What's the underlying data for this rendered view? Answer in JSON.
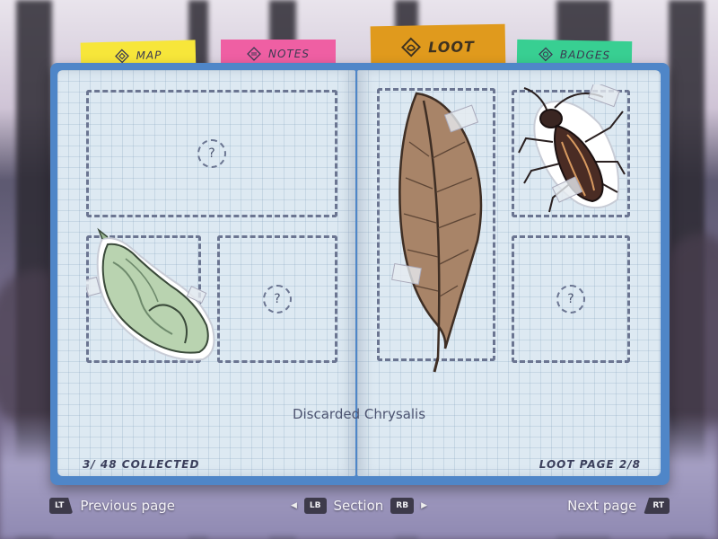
{
  "tabs": {
    "map": {
      "label": "MAP",
      "icon": "map-icon",
      "color": "#f7e63a"
    },
    "notes": {
      "label": "NOTES",
      "icon": "notes-icon",
      "color": "#ef5fa3"
    },
    "loot": {
      "label": "LOOT",
      "icon": "loot-icon",
      "color": "#e09a1d",
      "active": true
    },
    "badges": {
      "label": "BADGES",
      "icon": "badge-icon",
      "color": "#38cf92"
    }
  },
  "slots": {
    "unknown_symbol": "?"
  },
  "items": {
    "chrysalis": {
      "icon": "chrysalis-icon"
    },
    "feather": {
      "icon": "feather-icon"
    },
    "beetle": {
      "icon": "beetle-icon"
    }
  },
  "selected_item_name": "Discarded Chrysalis",
  "collected_text": "3/ 48 COLLECTED",
  "page_indicator": "LOOT PAGE   2/8",
  "nav": {
    "previous_button": "LT",
    "previous_label": "Previous page",
    "section_left_button": "LB",
    "section_label": "Section",
    "section_right_button": "RB",
    "next_label": "Next page",
    "next_button": "RT"
  },
  "colors": {
    "book_cover": "#4f86c8",
    "page": "#dde9f2",
    "dashed": "#6b7591"
  }
}
